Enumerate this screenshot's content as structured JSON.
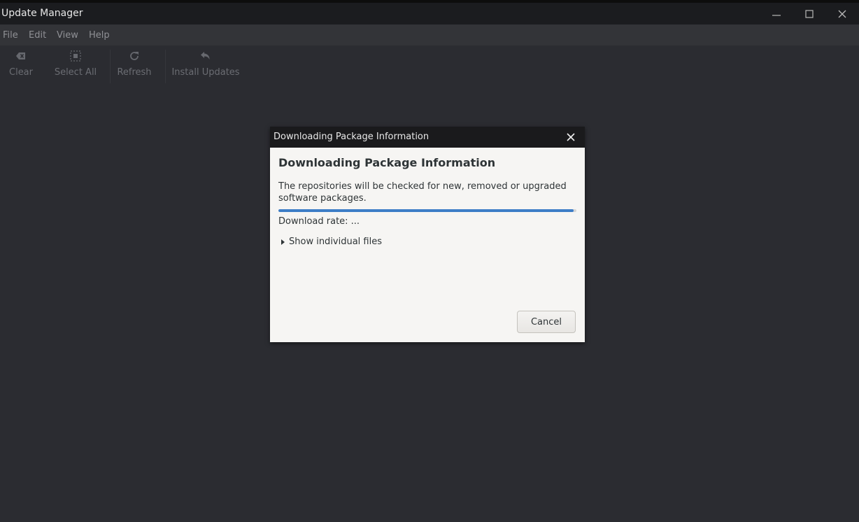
{
  "window": {
    "title": "Update Manager"
  },
  "menubar": {
    "items": [
      "File",
      "Edit",
      "View",
      "Help"
    ]
  },
  "toolbar": {
    "clear": {
      "label": "Clear",
      "icon": "backspace-icon"
    },
    "select_all": {
      "label": "Select All",
      "icon": "select-all-icon"
    },
    "refresh": {
      "label": "Refresh",
      "icon": "refresh-icon"
    },
    "install": {
      "label": "Install Updates",
      "icon": "undo-arrow-icon"
    }
  },
  "dialog": {
    "window_title": "Downloading Package Information",
    "heading": "Downloading Package Information",
    "description": "The repositories will be checked for new, removed or upgraded software packages.",
    "progress": 0.99,
    "download_rate": "Download rate: ...",
    "expander_label": "Show individual files",
    "cancel_label": "Cancel"
  },
  "colors": {
    "background": "#2b2c31",
    "titlebar": "#1b1c1f",
    "menubar": "#333438",
    "dialog_bg": "#f6f5f3",
    "progress": "#3d7dc7"
  }
}
